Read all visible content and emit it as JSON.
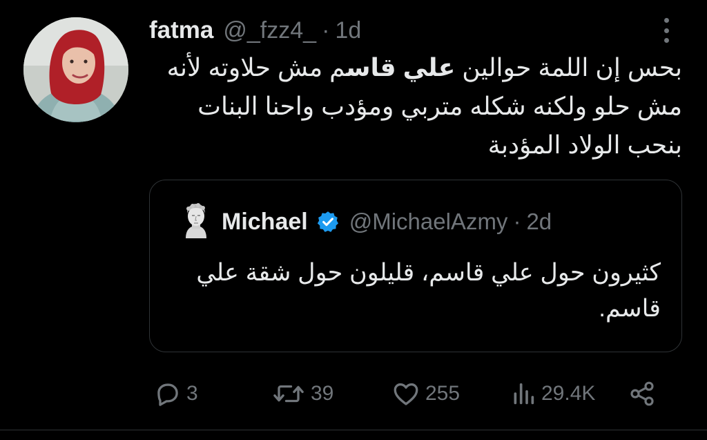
{
  "tweet": {
    "author": {
      "name": "fatma",
      "handle": "@_fzz4_",
      "time": "1d"
    },
    "text_segments": [
      "بحس إن اللمة حوالين ",
      "علي قاس",
      "م مش حلاوته لأنه مش حلو ولكنه شكله متربي ومؤدب واحنا البنات بنحب الولاد المؤدبة"
    ],
    "quote": {
      "name": "Michael",
      "handle": "@MichaelAzmy",
      "time": "2d",
      "text": "كثيرون حول علي قاسم، قليلون حول شقة علي قاسم."
    },
    "actions": {
      "replies": "3",
      "retweets": "39",
      "likes": "255",
      "views": "29.4K"
    },
    "separator": "·"
  },
  "colors": {
    "background": "#000000",
    "text": "#e7e9ea",
    "muted": "#71767b",
    "border": "#2f3336",
    "verified": "#1d9bf0"
  },
  "icons": [
    "more-icon",
    "verified-icon",
    "reply-icon",
    "retweet-icon",
    "like-icon",
    "views-icon",
    "share-icon"
  ]
}
